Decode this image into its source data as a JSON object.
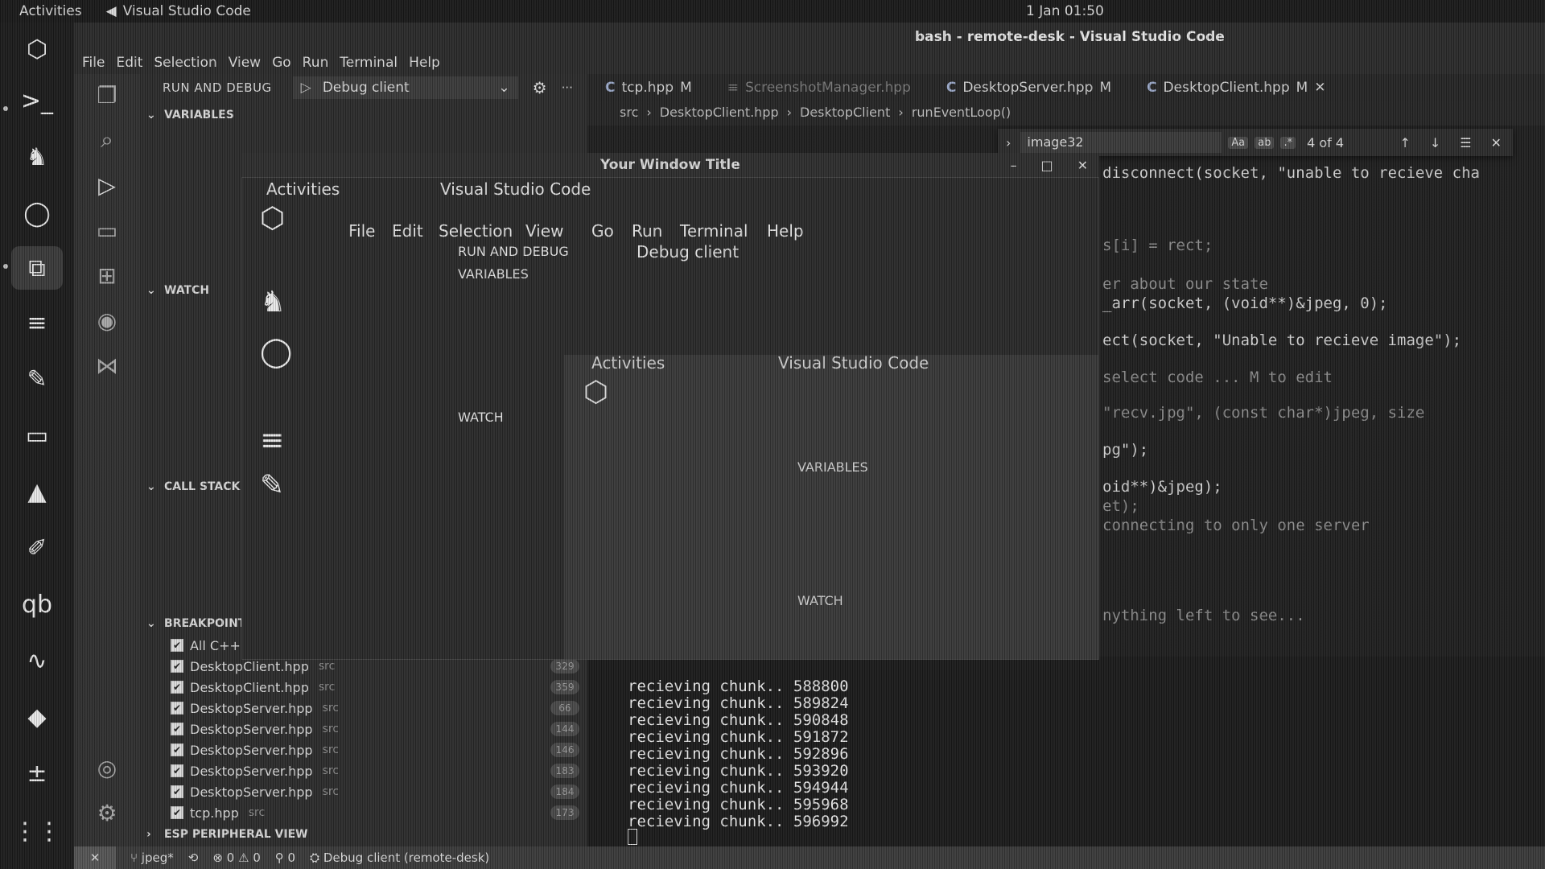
{
  "topbar": {
    "activities": "Activities",
    "app": "Visual Studio Code",
    "clock": "1 Jan 01:50"
  },
  "window": {
    "title": "bash - remote-desk - Visual Studio Code"
  },
  "menu": [
    "File",
    "Edit",
    "Selection",
    "View",
    "Go",
    "Run",
    "Terminal",
    "Help"
  ],
  "sidebar": {
    "title": "RUN AND DEBUG",
    "config": "Debug client",
    "sections": {
      "variables": "VARIABLES",
      "watch": "WATCH",
      "callstack": "CALL STACK",
      "breakpoints": "BREAKPOINTS",
      "esp": "ESP PERIPHERAL VIEW"
    },
    "breakpoints": [
      {
        "file": "All C++ Exceptions",
        "dir": "",
        "line": ""
      },
      {
        "file": "DesktopClient.hpp",
        "dir": "src",
        "line": "329"
      },
      {
        "file": "DesktopClient.hpp",
        "dir": "src",
        "line": "359"
      },
      {
        "file": "DesktopServer.hpp",
        "dir": "src",
        "line": "66"
      },
      {
        "file": "DesktopServer.hpp",
        "dir": "src",
        "line": "144"
      },
      {
        "file": "DesktopServer.hpp",
        "dir": "src",
        "line": "146"
      },
      {
        "file": "DesktopServer.hpp",
        "dir": "src",
        "line": "183"
      },
      {
        "file": "DesktopServer.hpp",
        "dir": "src",
        "line": "184"
      },
      {
        "file": "tcp.hpp",
        "dir": "src",
        "line": "173"
      }
    ]
  },
  "tabs": [
    {
      "label": "tcp.hpp",
      "mod": "M",
      "dim": false
    },
    {
      "label": "ScreenshotManager.hpp",
      "mod": "",
      "dim": true
    },
    {
      "label": "DesktopServer.hpp",
      "mod": "M",
      "dim": false
    },
    {
      "label": "DesktopClient.hpp",
      "mod": "M",
      "dim": false
    }
  ],
  "breadcrumb": [
    "src",
    "DesktopClient.hpp",
    "DesktopClient",
    "runEventLoop()"
  ],
  "find": {
    "query": "image32",
    "case": "Aa",
    "word": "ab",
    "regex": ".*",
    "count": "4 of 4"
  },
  "code": [
    "disconnect(socket, \"unable to recieve cha",
    "s[i] = rect;",
    "er about our state",
    "_arr(socket, (void**)&jpeg, 0);",
    "ect(socket, \"Unable to recieve image\");",
    "select code ... M to edit",
    "\"recv.jpg\", (const char*)jpeg, size",
    "pg\");",
    "oid**)&jpeg);",
    "et);",
    "connecting to only one server",
    "nything left to see..."
  ],
  "terminal": [
    "recieving chunk.. 588800",
    "recieving chunk.. 589824",
    "recieving chunk.. 590848",
    "recieving chunk.. 591872",
    "recieving chunk.. 592896",
    "recieving chunk.. 593920",
    "recieving chunk.. 594944",
    "recieving chunk.. 595968",
    "recieving chunk.. 596992"
  ],
  "nested": {
    "title": "Your Window Title",
    "activities": "Activities",
    "app": "Visual Studio Code",
    "menu": [
      "File",
      "Edit",
      "Selection",
      "View",
      "Go",
      "Run",
      "Terminal",
      "Help"
    ],
    "debugTitle": "RUN AND DEBUG",
    "config": "Debug client",
    "variables": "VARIABLES",
    "watch": "WATCH"
  },
  "status": {
    "branch": "jpeg*",
    "errors": "0",
    "warnings": "0",
    "ports": "0",
    "debug": "Debug client (remote-desk)"
  }
}
